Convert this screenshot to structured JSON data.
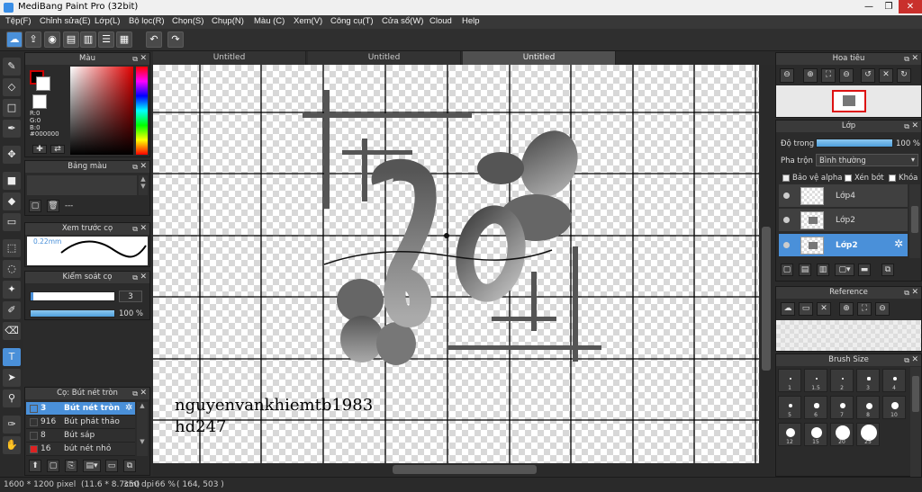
{
  "window": {
    "title": "MediBang Paint Pro (32bit)"
  },
  "menu": [
    "Tệp(F)",
    "Chỉnh sửa(E)",
    "Lớp(L)",
    "Bộ lọc(R)",
    "Chọn(S)",
    "Chụp(N)",
    "Màu (C)",
    "Xem(V)",
    "Công cụ(T)",
    "Cửa sổ(W)",
    "Cloud",
    "Help"
  ],
  "tabs": [
    "Untitled",
    "Untitled",
    "Untitled"
  ],
  "color_panel": {
    "title": "Màu",
    "r": "R:0",
    "g": "G:0",
    "b": "B:0",
    "hex": "#000000",
    "fg": "#000000",
    "bg": "#ffffff",
    "accent": "#cc0000"
  },
  "palette_panel": {
    "title": "Bảng màu",
    "placeholder": "---"
  },
  "preview_panel": {
    "title": "Xem trước cọ",
    "size": "0.22mm"
  },
  "brush_control_panel": {
    "title": "Kiểm soát cọ",
    "size_value": "3",
    "opacity_value": "100 %",
    "opacity_fill": 1.0
  },
  "brush_list": {
    "title": "Cọ: Bút nét tròn",
    "items": [
      {
        "size": "3",
        "name": "Bút nét tròn",
        "color": "#4a90d9"
      },
      {
        "size": "916",
        "name": "Bút phát thảo",
        "color": "#333333"
      },
      {
        "size": "8",
        "name": "Bút sáp",
        "color": "#333333"
      },
      {
        "size": "16",
        "name": "bút nét nhỏ",
        "color": "#dd2222"
      }
    ]
  },
  "navigator": {
    "title": "Hoa tiêu"
  },
  "layer_panel": {
    "title": "Lớp",
    "opacity_label": "Độ trong",
    "opacity_value": "100 %",
    "opacity_fill": 1.0,
    "blend_label": "Pha trộn",
    "blend_value": "Bình thường",
    "protect_alpha": "Bảo vệ alpha",
    "clipping": "Xén bớt",
    "lock": "Khóa",
    "layers": [
      "Lớp4",
      "Lớp2",
      "Lớp2"
    ]
  },
  "reference_panel": {
    "title": "Reference"
  },
  "brush_size_panel": {
    "title": "Brush Size",
    "sizes": [
      "1",
      "1.5",
      "2",
      "3",
      "4",
      "5",
      "6",
      "7",
      "8",
      "10",
      "12",
      "15",
      "20",
      "25"
    ]
  },
  "canvas": {
    "watermark_line1": "nguyenvankhiemtb1983",
    "watermark_line2": "hd247"
  },
  "status": {
    "pixels": "1600 * 1200 pixel",
    "cm": "(11.6 * 8.7cm)",
    "dpi": "350 dpi",
    "zoom": "66 %",
    "cursor": "( 164, 503 )"
  }
}
